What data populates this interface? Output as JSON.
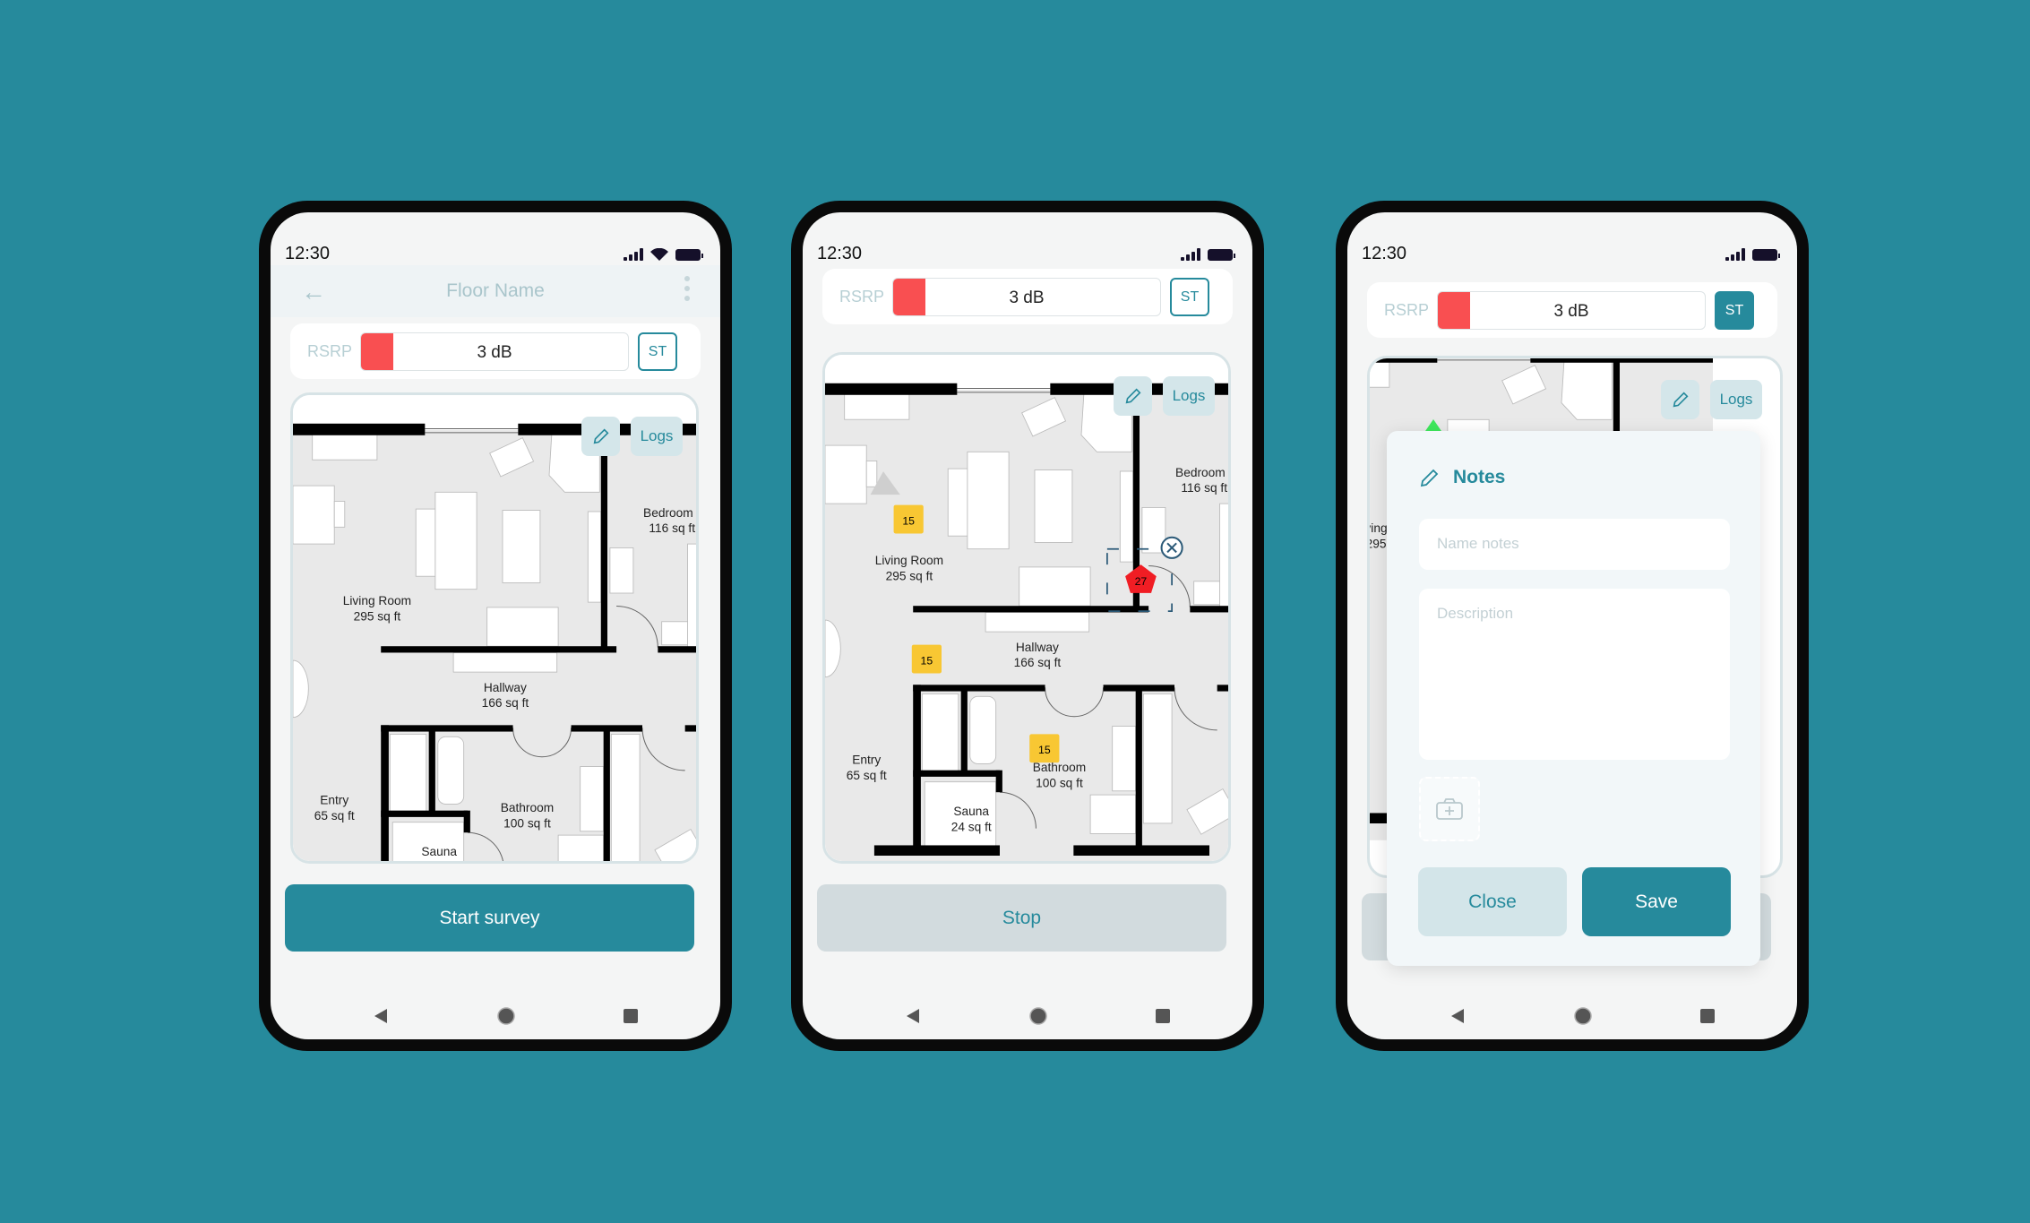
{
  "colors": {
    "background": "#268a9c",
    "accent": "#268a9c",
    "signal_fill": "#f94f51",
    "marker_yellow": "#f8c733",
    "marker_red": "#f01d24"
  },
  "status_bar": {
    "time": "12:30"
  },
  "floorplan": {
    "rooms": [
      {
        "name": "Living Room",
        "area": "295 sq ft"
      },
      {
        "name": "Bedroom",
        "area": "116 sq ft"
      },
      {
        "name": "Hallway",
        "area": "166 sq ft"
      },
      {
        "name": "Entry",
        "area": "65 sq ft"
      },
      {
        "name": "Bathroom",
        "area": "100 sq ft"
      },
      {
        "name": "Sauna",
        "area": "24 sq ft"
      }
    ]
  },
  "screens": [
    {
      "header": {
        "title": "Floor Name",
        "back_icon": "arrow-left-icon",
        "menu_icon": "more-vertical-icon"
      },
      "rsrp": {
        "label": "RSRP",
        "value": "3 dB",
        "level_percent": 12,
        "st_label": "ST"
      },
      "map": {
        "edit_icon": "pencil-icon",
        "logs_label": "Logs"
      },
      "action_button": "Start survey"
    },
    {
      "rsrp": {
        "label": "RSRP",
        "value": "3 dB",
        "level_percent": 12,
        "st_label": "ST"
      },
      "map": {
        "edit_icon": "pencil-icon",
        "logs_label": "Logs",
        "markers": [
          {
            "value": "15",
            "color": "yellow"
          },
          {
            "value": "15",
            "color": "yellow"
          },
          {
            "value": "15",
            "color": "yellow"
          },
          {
            "value": "27",
            "color": "red",
            "selected": true
          }
        ]
      },
      "action_button": "Stop"
    },
    {
      "rsrp": {
        "label": "RSRP",
        "value": "3 dB",
        "level_percent": 12,
        "st_label": "ST"
      },
      "map": {
        "edit_icon": "pencil-icon",
        "logs_label": "Logs"
      },
      "notes_dialog": {
        "title": "Notes",
        "name_placeholder": "Name notes",
        "description_placeholder": "Description",
        "add_photo_icon": "camera-plus-icon",
        "close_label": "Close",
        "save_label": "Save"
      }
    }
  ],
  "nav": {
    "back_icon": "triangle-back-icon",
    "home_icon": "circle-home-icon",
    "recents_icon": "square-recents-icon"
  }
}
